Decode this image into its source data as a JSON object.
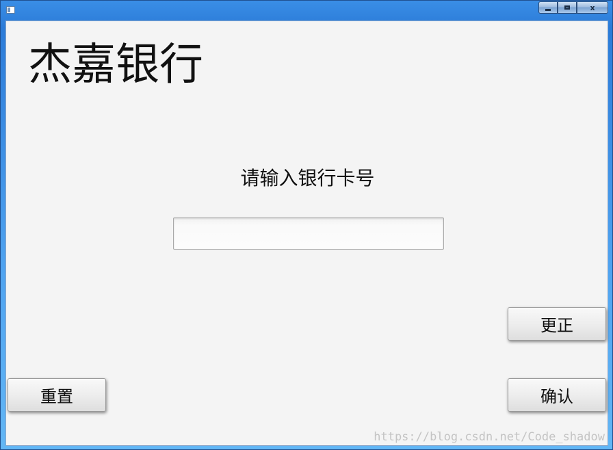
{
  "window": {
    "controls": {
      "minimize_icon": "minimize-icon",
      "maximize_icon": "maximize-icon",
      "close_label": "x"
    }
  },
  "main": {
    "title": "杰嘉银行",
    "prompt": "请输入银行卡号",
    "card_input": {
      "value": "",
      "placeholder": ""
    },
    "buttons": {
      "correct": "更正",
      "confirm": "确认",
      "reset": "重置"
    }
  },
  "watermark": "https://blog.csdn.net/Code_shadow",
  "colors": {
    "titlebar": "#2b7bd8",
    "client_bg": "#f4f4f4",
    "button_face": "#ececec"
  }
}
